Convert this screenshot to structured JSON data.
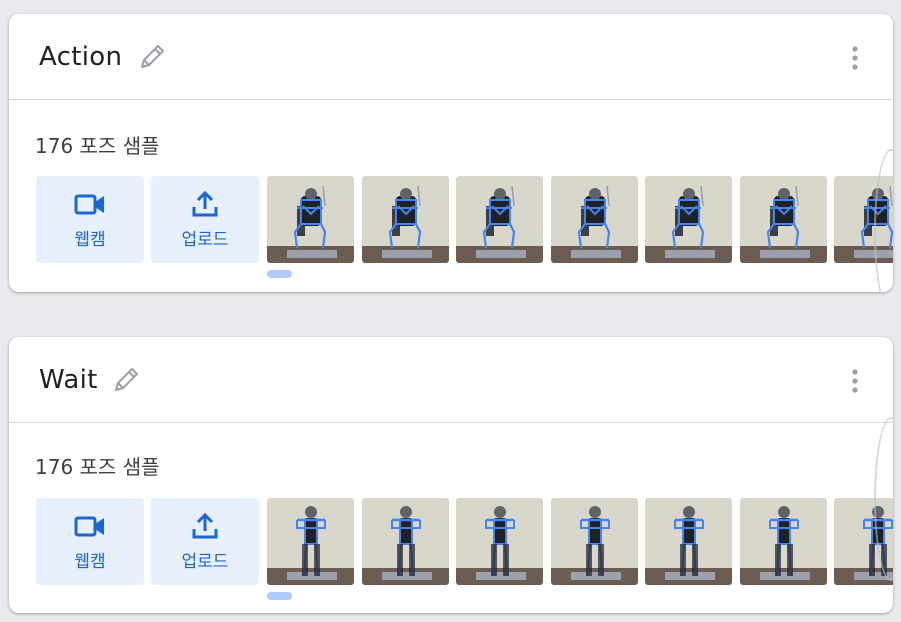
{
  "classes": [
    {
      "name": "Action",
      "sample_count": "176 포즈 샘플",
      "webcam_label": "웹캠",
      "upload_label": "업로드",
      "pose": "sitting",
      "thumbnails": 7
    },
    {
      "name": "Wait",
      "sample_count": "176 포즈 샘플",
      "webcam_label": "웹캠",
      "upload_label": "업로드",
      "pose": "standing",
      "thumbnails": 7
    }
  ],
  "colors": {
    "accent": "#1967d2",
    "button_bg": "#e8f0fe",
    "skeleton": "#4285f4",
    "page_bg": "#e8eaed"
  },
  "icons": [
    "edit-pencil-icon",
    "more-vert-icon",
    "videocam-icon",
    "upload-icon"
  ]
}
